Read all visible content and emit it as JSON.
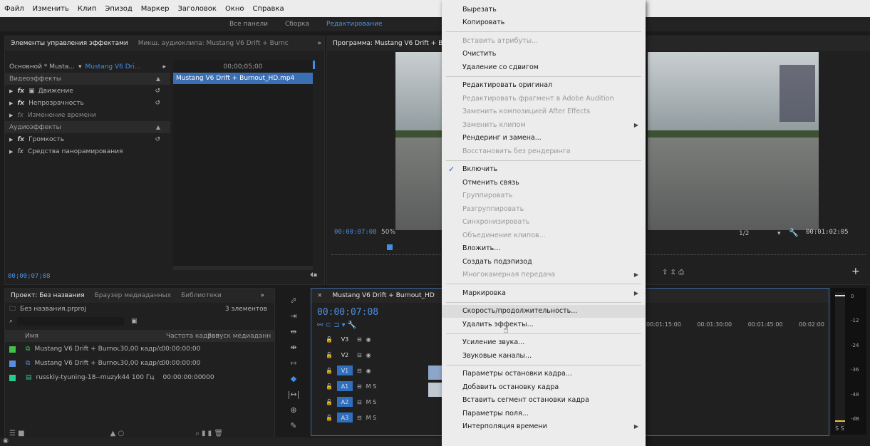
{
  "menubar": [
    "Файл",
    "Изменить",
    "Клип",
    "Эпизод",
    "Маркер",
    "Заголовок",
    "Окно",
    "Справка"
  ],
  "workspaces": {
    "all": "Все панели",
    "assembly": "Сборка",
    "editing": "Редактирование"
  },
  "effects_panel": {
    "tab_active": "Элементы управления эффектами",
    "tab_inactive": "Микш. аудиоклипа: Mustang V6 Drift + Burnc",
    "master": "Основной * Musta...",
    "clip": "Mustang V6 Dri...",
    "ruler_time": "00;00;05;00",
    "clip_bar": "Mustang V6 Drift + Burnout_HD.mp4",
    "video_effects": "Видеоэффекты",
    "motion": "Движение",
    "opacity": "Непрозрачность",
    "time_remap": "Изменение времени",
    "audio_effects": "Аудиоэффекты",
    "volume": "Громкость",
    "panner": "Средства панорамирования",
    "timecode": "00;00;07;08"
  },
  "program_monitor": {
    "title": "Программа: Mustang V6 Drift + B",
    "timecode": "00:00:07:08",
    "zoom": "50%",
    "resolution": "1/2",
    "duration": "00:01:02:05"
  },
  "project_panel": {
    "tab_active": "Проект: Без названия",
    "tab_media": "Браузер медиаданных",
    "tab_lib": "Библиотеки",
    "file": "Без названия.prproj",
    "count": "3 элементов",
    "col_name": "Имя",
    "col_fps": "Частота кадров",
    "col_start": "Запуск медиаданн",
    "items": [
      {
        "name": "Mustang V6 Drift + Burnou",
        "fps": "30,00 кадр/с",
        "start": "00:00:00:00",
        "color": "#3fc24a"
      },
      {
        "name": "Mustang V6 Drift + Burnou",
        "fps": "30,00 кадр/с",
        "start": "00:00:00:00",
        "color": "#5a8de0"
      },
      {
        "name": "russkiy-tyuning-18--muzyk",
        "fps": "44 100 Гц",
        "start": "00:00:00:00000",
        "color": "#27c98c"
      }
    ]
  },
  "timeline": {
    "tab": "Mustang V6 Drift + Burnout_HD",
    "timecode": "00:00:07:08",
    "ruler": [
      "00:01:15:00",
      "00:01:30:00",
      "00:01:45:00",
      "00:02:00"
    ],
    "tracks": [
      {
        "label": "V3",
        "on": false,
        "extra": ""
      },
      {
        "label": "V2",
        "on": false,
        "extra": ""
      },
      {
        "label": "V1",
        "on": true,
        "extra": ""
      },
      {
        "label": "A1",
        "on": true,
        "extra": "M  S"
      },
      {
        "label": "A2",
        "on": true,
        "extra": "M  S"
      },
      {
        "label": "A3",
        "on": true,
        "extra": "M  S"
      }
    ],
    "meter_labels": [
      "0",
      "-12",
      "-24",
      "-36",
      "-48",
      "-dB"
    ],
    "meter_bottom": "S  S"
  },
  "context_menu": {
    "items": [
      {
        "label": "Вырезать",
        "disabled": false
      },
      {
        "label": "Копировать",
        "disabled": false
      },
      {
        "label": "Вставить атрибуты...",
        "disabled": true
      },
      {
        "label": "Очистить",
        "disabled": false
      },
      {
        "label": "Удаление со сдвигом",
        "disabled": false
      },
      {
        "label": "Редактировать оригинал",
        "disabled": false
      },
      {
        "label": "Редактировать фрагмент в Adobe Audition",
        "disabled": true
      },
      {
        "label": "Заменить композицией After Effects",
        "disabled": true
      },
      {
        "label": "Заменить клипом",
        "disabled": true,
        "submenu": true
      },
      {
        "label": "Рендеринг и замена...",
        "disabled": false
      },
      {
        "label": "Восстановить без рендеринга",
        "disabled": true
      },
      {
        "label": "Включить",
        "disabled": false,
        "checked": true
      },
      {
        "label": "Отменить связь",
        "disabled": false
      },
      {
        "label": "Группировать",
        "disabled": true
      },
      {
        "label": "Разгруппировать",
        "disabled": true
      },
      {
        "label": "Синхронизировать",
        "disabled": true
      },
      {
        "label": "Объединение клипов...",
        "disabled": true
      },
      {
        "label": "Вложить...",
        "disabled": false
      },
      {
        "label": "Создать подэпизод",
        "disabled": false
      },
      {
        "label": "Многокамерная передача",
        "disabled": true,
        "submenu": true
      },
      {
        "label": "Маркировка",
        "disabled": false,
        "submenu": true
      },
      {
        "label": "Скорость/продолжительность...",
        "disabled": false,
        "highlight": true
      },
      {
        "label": "Удалить эффекты...",
        "disabled": false
      },
      {
        "label": "Усиление звука...",
        "disabled": false
      },
      {
        "label": "Звуковые каналы...",
        "disabled": false
      },
      {
        "label": "Параметры остановки кадра...",
        "disabled": false
      },
      {
        "label": "Добавить остановку кадра",
        "disabled": false
      },
      {
        "label": "Вставить сегмент остановки кадра",
        "disabled": false
      },
      {
        "label": "Параметры поля...",
        "disabled": false
      },
      {
        "label": "Интерполяция времени",
        "disabled": false,
        "submenu": true
      }
    ]
  }
}
